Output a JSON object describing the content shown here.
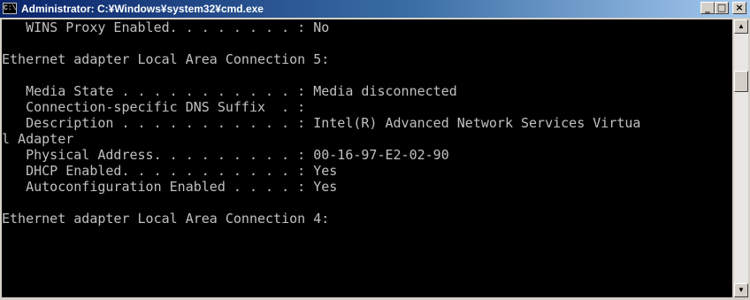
{
  "window": {
    "title": "Administrator: C:¥Windows¥system32¥cmd.exe",
    "icon": "console-app-icon",
    "buttons": {
      "minimize": "_",
      "maximize": "□",
      "close": "×"
    }
  },
  "console": {
    "lines": [
      "   WINS Proxy Enabled. . . . . . . . : No",
      "",
      "Ethernet adapter Local Area Connection 5:",
      "",
      "   Media State . . . . . . . . . . . : Media disconnected",
      "   Connection-specific DNS Suffix  . :",
      "   Description . . . . . . . . . . . : Intel(R) Advanced Network Services Virtua",
      "l Adapter",
      "   Physical Address. . . . . . . . . : 00-16-97-E2-02-90",
      "   DHCP Enabled. . . . . . . . . . . : Yes",
      "   Autoconfiguration Enabled . . . . : Yes",
      "",
      "Ethernet adapter Local Area Connection 4:"
    ]
  },
  "colors": {
    "console_bg": "#000000",
    "console_text": "#c0c0c0",
    "titlebar_start": "#0a246a",
    "titlebar_end": "#a6caf0"
  }
}
